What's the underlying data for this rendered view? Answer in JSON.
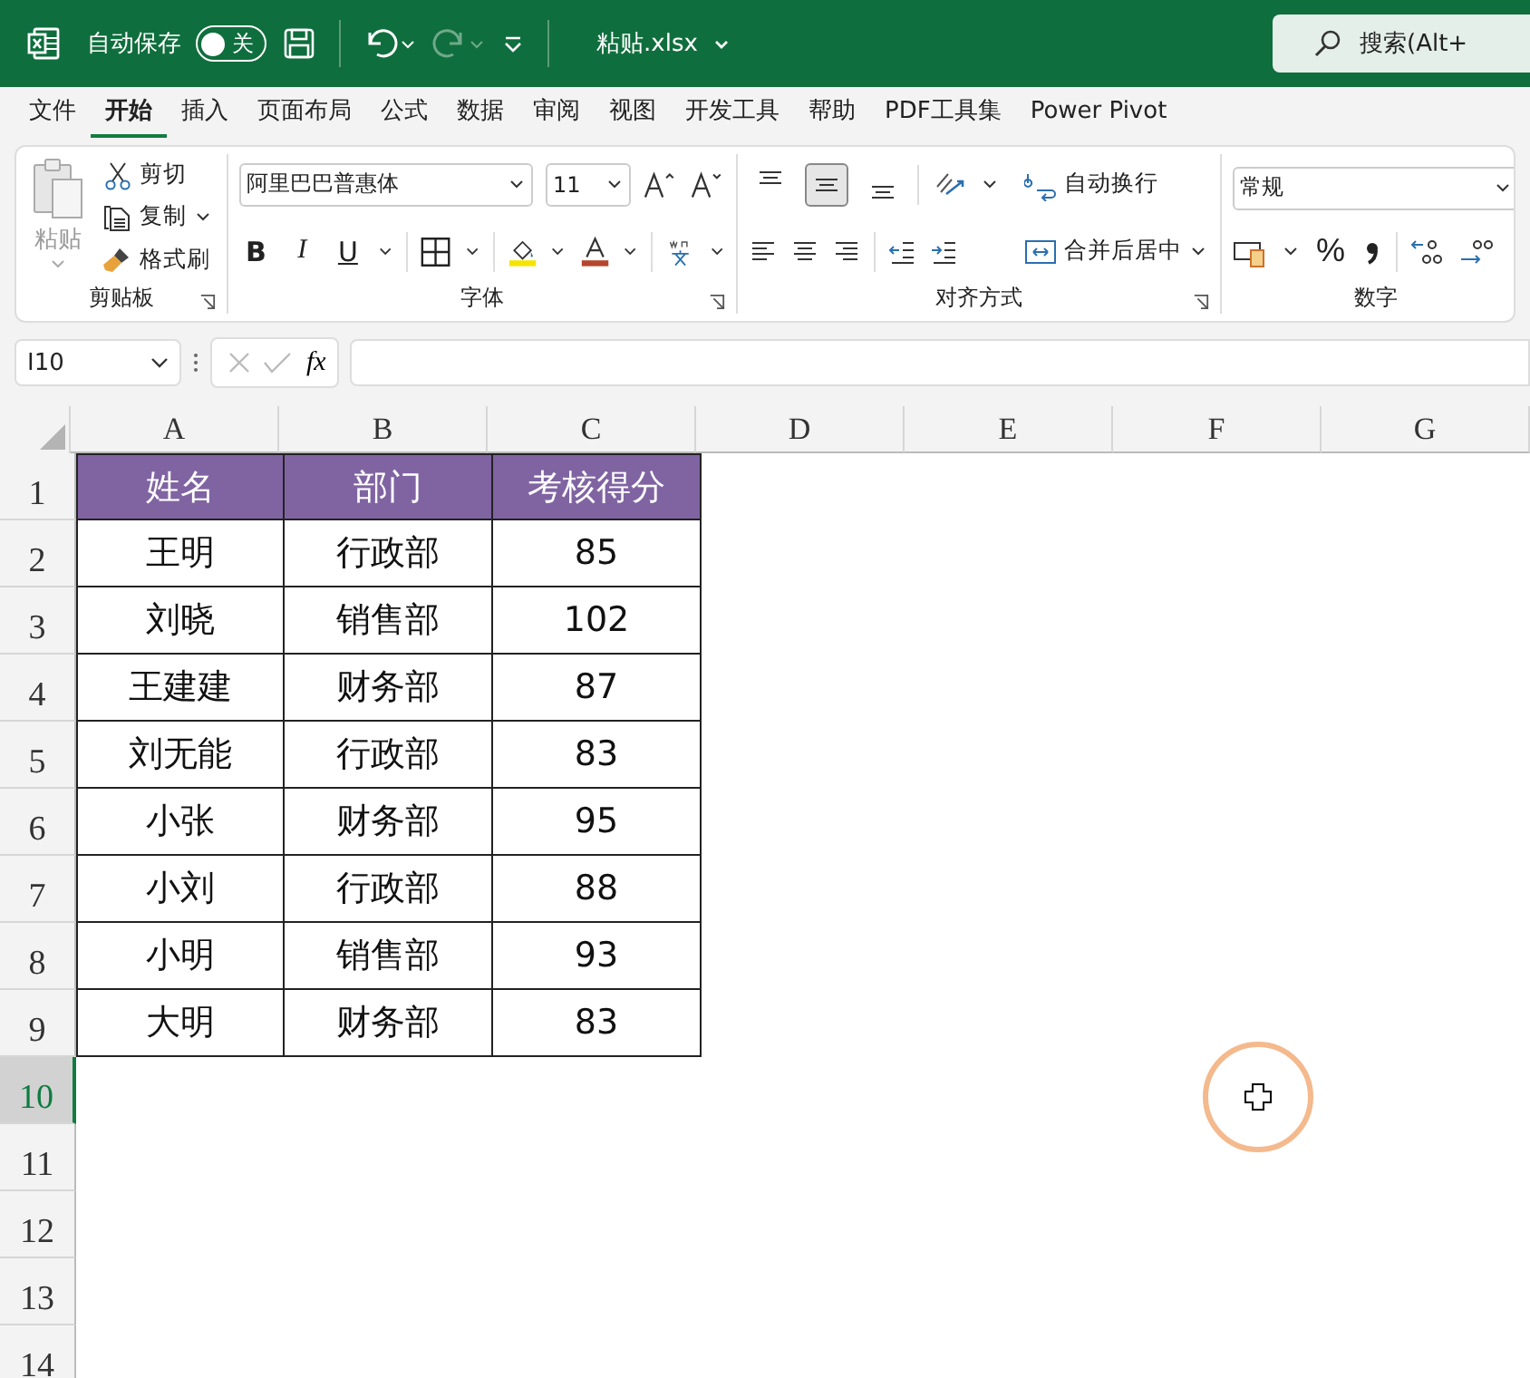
{
  "title_bar": {
    "autosave_label": "自动保存",
    "autosave": {
      "label": "关",
      "on": false
    },
    "filename": "粘贴.xlsx",
    "search_placeholder": "搜索(Alt+"
  },
  "menu_tabs": [
    {
      "label": "文件",
      "selected": false
    },
    {
      "label": "开始",
      "selected": true
    },
    {
      "label": "插入",
      "selected": false
    },
    {
      "label": "页面布局",
      "selected": false
    },
    {
      "label": "公式",
      "selected": false
    },
    {
      "label": "数据",
      "selected": false
    },
    {
      "label": "审阅",
      "selected": false
    },
    {
      "label": "视图",
      "selected": false
    },
    {
      "label": "开发工具",
      "selected": false
    },
    {
      "label": "帮助",
      "selected": false
    },
    {
      "label": "PDF工具集",
      "selected": false
    },
    {
      "label": "Power Pivot",
      "selected": false
    }
  ],
  "ribbon": {
    "clipboard": {
      "paste": "粘贴",
      "cut": "剪切",
      "copy": "复制",
      "format_painter": "格式刷",
      "label": "剪贴板"
    },
    "font": {
      "font_name": "阿里巴巴普惠体",
      "font_size": "11",
      "bold": "B",
      "italic": "I",
      "underline": "U",
      "label": "字体"
    },
    "alignment": {
      "vertical": [
        {
          "selected": false
        },
        {
          "selected": true
        },
        {
          "selected": false
        }
      ],
      "wrap_text": "自动换行",
      "merge_center": "合并后居中",
      "label": "对齐方式"
    },
    "number": {
      "format": "常规",
      "percent": "%",
      "label": "数字"
    }
  },
  "formula_bar": {
    "name_box": "I10",
    "fx": "fx"
  },
  "sheet": {
    "columns": [
      "A",
      "B",
      "C",
      "D",
      "E",
      "F",
      "G"
    ],
    "rows": [
      {
        "number": "1",
        "selected": false,
        "kind": "header",
        "cells": [
          "姓名",
          "部门",
          "考核得分"
        ]
      },
      {
        "number": "2",
        "selected": false,
        "kind": "data",
        "cells": [
          "王明",
          "行政部",
          "85"
        ]
      },
      {
        "number": "3",
        "selected": false,
        "kind": "data",
        "cells": [
          "刘晓",
          "销售部",
          "102"
        ]
      },
      {
        "number": "4",
        "selected": false,
        "kind": "data",
        "cells": [
          "王建建",
          "财务部",
          "87"
        ]
      },
      {
        "number": "5",
        "selected": false,
        "kind": "data",
        "cells": [
          "刘无能",
          "行政部",
          "83"
        ]
      },
      {
        "number": "6",
        "selected": false,
        "kind": "data",
        "cells": [
          "小张",
          "财务部",
          "95"
        ]
      },
      {
        "number": "7",
        "selected": false,
        "kind": "data",
        "cells": [
          "小刘",
          "行政部",
          "88"
        ]
      },
      {
        "number": "8",
        "selected": false,
        "kind": "data",
        "cells": [
          "小明",
          "销售部",
          "93"
        ]
      },
      {
        "number": "9",
        "selected": false,
        "kind": "data",
        "cells": [
          "大明",
          "财务部",
          "83"
        ]
      },
      {
        "number": "10",
        "selected": true,
        "kind": "empty"
      },
      {
        "number": "11",
        "selected": false,
        "kind": "empty"
      },
      {
        "number": "12",
        "selected": false,
        "kind": "empty"
      },
      {
        "number": "13",
        "selected": false,
        "kind": "empty"
      },
      {
        "number": "14",
        "selected": false,
        "kind": "empty"
      }
    ]
  }
}
